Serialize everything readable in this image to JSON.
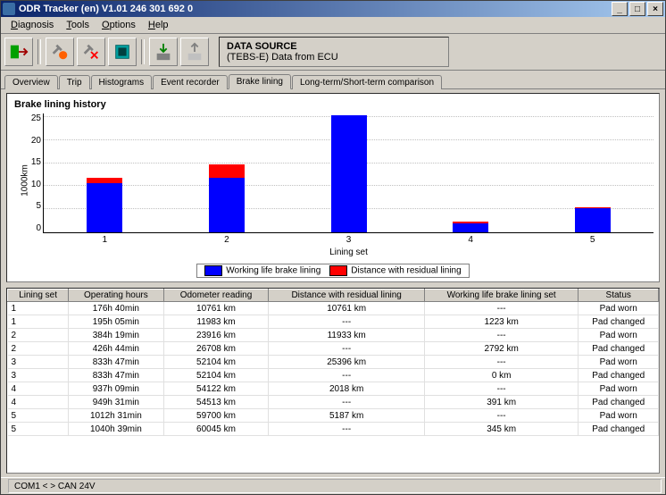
{
  "window": {
    "title": "ODR Tracker (en) V1.01  246 301 692 0"
  },
  "menu": [
    "Diagnosis",
    "Tools",
    "Options",
    "Help"
  ],
  "datasource": {
    "line1": "DATA SOURCE",
    "line2": "(TEBS-E) Data from ECU"
  },
  "tabs": [
    "Overview",
    "Trip",
    "Histograms",
    "Event recorder",
    "Brake lining",
    "Long-term/Short-term comparison"
  ],
  "active_tab": 4,
  "chart_title": "Brake lining history",
  "chart_data": {
    "type": "bar",
    "categories": [
      "1",
      "2",
      "3",
      "4",
      "5"
    ],
    "ylabel": "1000km",
    "xlabel": "Lining set",
    "ylim": [
      0,
      26
    ],
    "yticks": [
      0,
      5,
      10,
      15,
      20,
      25
    ],
    "series": [
      {
        "name": "Working life brake lining",
        "color": "#0000ff",
        "values": [
          10.7,
          11.9,
          25.4,
          2.0,
          5.2
        ]
      },
      {
        "name": "Distance with residual lining",
        "color": "#ff0000",
        "values": [
          1.2,
          2.8,
          0.0,
          0.4,
          0.3
        ]
      }
    ]
  },
  "table": {
    "headers": [
      "Lining set",
      "Operating hours",
      "Odometer reading",
      "Distance with residual lining",
      "Working life brake lining set",
      "Status"
    ],
    "rows": [
      [
        "1",
        "176h 40min",
        "10761 km",
        "10761 km",
        "---",
        "Pad worn"
      ],
      [
        "1",
        "195h 05min",
        "11983 km",
        "---",
        "1223 km",
        "Pad changed"
      ],
      [
        "2",
        "384h 19min",
        "23916 km",
        "11933 km",
        "---",
        "Pad worn"
      ],
      [
        "2",
        "426h 44min",
        "26708 km",
        "---",
        "2792 km",
        "Pad changed"
      ],
      [
        "3",
        "833h 47min",
        "52104 km",
        "25396 km",
        "---",
        "Pad worn"
      ],
      [
        "3",
        "833h 47min",
        "52104 km",
        "---",
        "0 km",
        "Pad changed"
      ],
      [
        "4",
        "937h 09min",
        "54122 km",
        "2018 km",
        "---",
        "Pad worn"
      ],
      [
        "4",
        "949h 31min",
        "54513 km",
        "---",
        "391 km",
        "Pad changed"
      ],
      [
        "5",
        "1012h 31min",
        "59700 km",
        "5187 km",
        "---",
        "Pad worn"
      ],
      [
        "5",
        "1040h 39min",
        "60045 km",
        "---",
        "345 km",
        "Pad changed"
      ]
    ]
  },
  "status": {
    "right": "COM1 < > CAN 24V"
  }
}
